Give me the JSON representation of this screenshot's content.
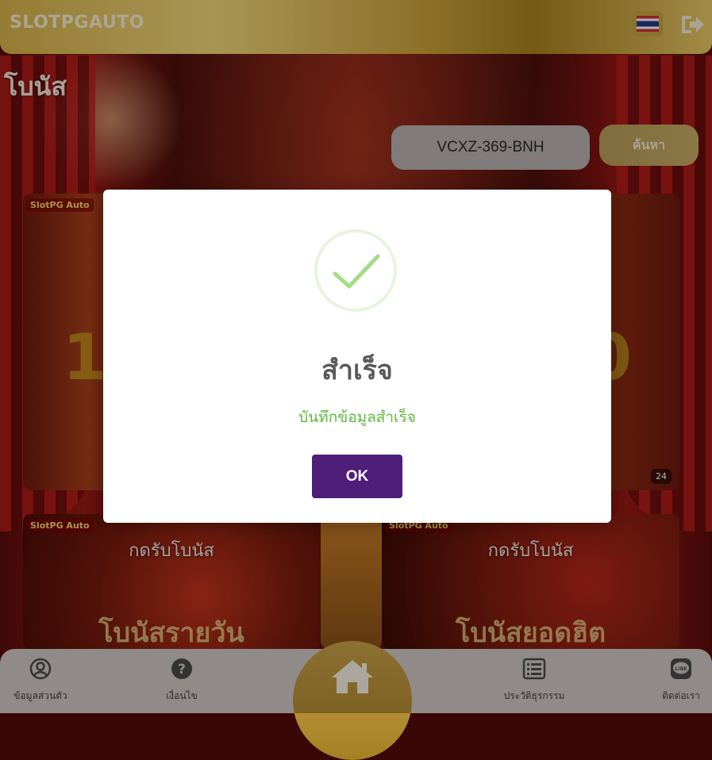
{
  "header": {
    "logo_text": "SLOTPGAUTO",
    "language_icon": "thailand-flag-icon",
    "logout_icon": "logout-icon"
  },
  "page": {
    "title": "โบนัส"
  },
  "search": {
    "value": "VCXZ-369-BNH",
    "button_label": "ค้นหา"
  },
  "banners": [
    {
      "label": "กดรับโบนัส",
      "sub": "โบนัสรายวัน",
      "logo": "SlotPG Auto"
    },
    {
      "label": "กดรับโบนัส",
      "sub": "โบนัสยอดฮิต",
      "logo": "SlotPG Auto"
    }
  ],
  "bottom_nav": {
    "items": [
      {
        "label": "ข้อมูลส่วนตัว",
        "icon": "user-circle-icon"
      },
      {
        "label": "เงื่อนไข",
        "icon": "question-icon"
      },
      {
        "label": "",
        "icon": "home-icon"
      },
      {
        "label": "ประวัติธุรกรรม",
        "icon": "list-icon"
      },
      {
        "label": "ติดต่อเรา",
        "icon": "line-icon"
      }
    ]
  },
  "modal": {
    "icon": "success-check-icon",
    "title": "สำเร็จ",
    "message": "บันทึกข้อมูลสำเร็จ",
    "ok_label": "OK"
  },
  "colors": {
    "gold": "#c9a13a",
    "modal_button": "#4e1e78",
    "success_green": "#5dbb3c",
    "check_green": "#a5dc86"
  }
}
